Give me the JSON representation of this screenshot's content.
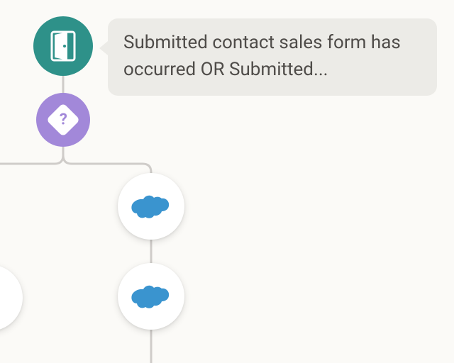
{
  "trigger": {
    "label": "Submitted contact sales form has occurred OR Submitted...",
    "icon": "door-icon",
    "color": "#2e9189"
  },
  "condition": {
    "icon": "question-diamond-icon",
    "symbol": "?",
    "color": "#a288d9"
  },
  "actions": [
    {
      "icon": "salesforce-cloud-icon",
      "color": "#3a94cf"
    },
    {
      "icon": "salesforce-cloud-icon",
      "color": "#3a94cf"
    }
  ],
  "colors": {
    "background": "#fbfaf7",
    "connector": "#cfccc9",
    "tooltip_bg": "#ecebe7",
    "text": "#4f4c49"
  }
}
